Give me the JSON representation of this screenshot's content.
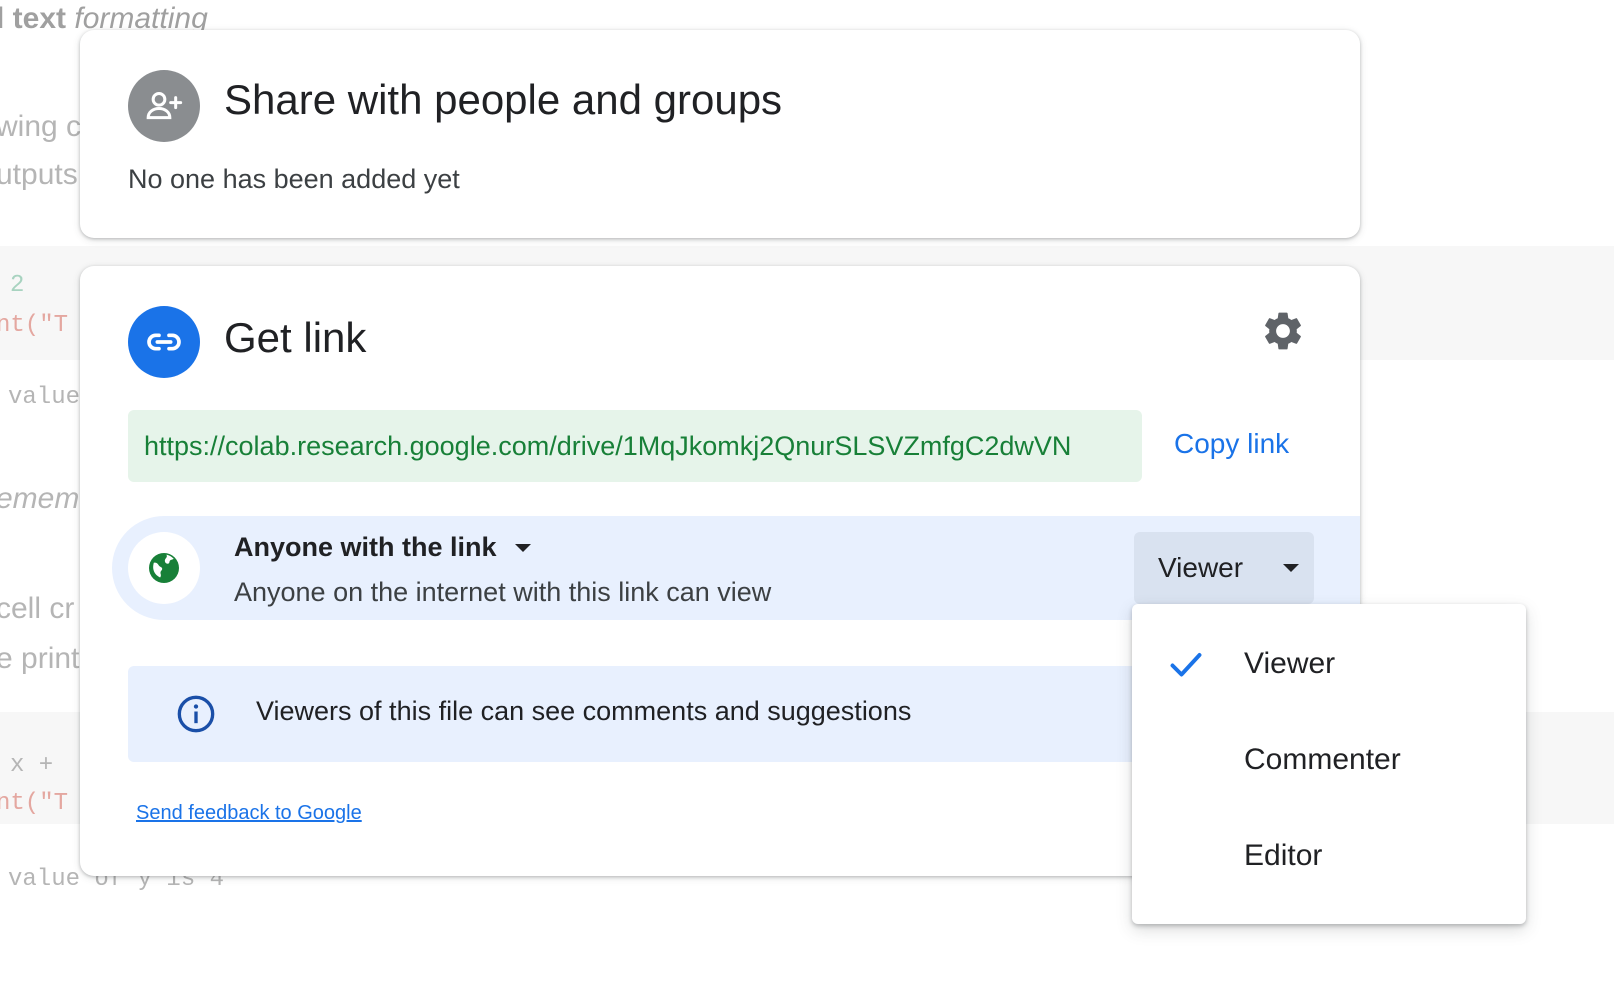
{
  "background": {
    "notebook_fragments": [
      "l text",
      "formatting",
      "wing c",
      "utputs",
      "2",
      "nt(\"T",
      "value",
      "emem",
      "cell cr",
      "e print",
      "x + ",
      "nt(\"T",
      "value of y is 4"
    ]
  },
  "share_card": {
    "title": "Share with people and groups",
    "subtitle": "No one has been added yet",
    "icon": "person-add-icon"
  },
  "link_card": {
    "title": "Get link",
    "icon": "link-icon",
    "settings_icon": "gear-icon",
    "url": "https://colab.research.google.com/drive/1MqJkomkj2QnurSLSVZmfgC2dwVN",
    "copy_label": "Copy link",
    "access": {
      "icon": "globe-icon",
      "title": "Anyone with the link",
      "description": "Anyone on the internet with this link can view"
    },
    "role_button": {
      "label": "Viewer"
    },
    "info": {
      "icon": "info-icon",
      "text": "Viewers of this file can see comments and suggestions"
    },
    "feedback_label": "Send feedback to Google"
  },
  "role_menu": {
    "items": [
      {
        "label": "Viewer",
        "selected": true
      },
      {
        "label": "Commenter",
        "selected": false
      },
      {
        "label": "Editor",
        "selected": false
      }
    ]
  },
  "colors": {
    "accent": "#1a73e8",
    "url_bg": "#e6f4ea",
    "url_text": "#188038",
    "access_bg": "#e8f0fe",
    "globe": "#188038"
  }
}
